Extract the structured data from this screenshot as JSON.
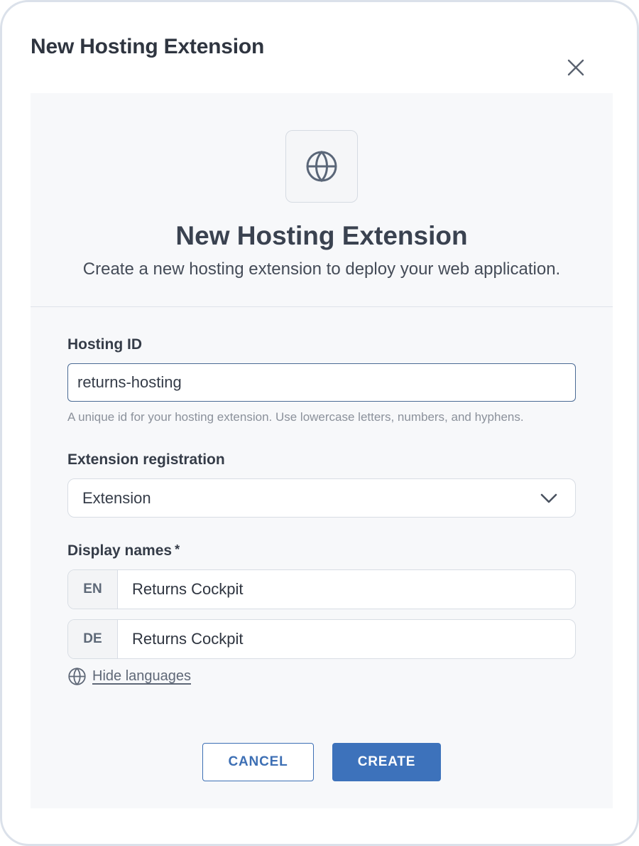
{
  "dialog": {
    "title": "New Hosting Extension"
  },
  "hero": {
    "icon": "globe-icon",
    "title": "New Hosting Extension",
    "subtitle": "Create a new hosting extension to deploy your web application."
  },
  "form": {
    "hosting_id": {
      "label": "Hosting ID",
      "value": "returns-hosting",
      "hint": "A unique id for your hosting extension. Use lowercase letters, numbers, and hyphens."
    },
    "registration": {
      "label": "Extension registration",
      "selected": "Extension"
    },
    "display_names": {
      "label": "Display names",
      "required_marker": "*",
      "languages": [
        {
          "code": "EN",
          "value": "Returns Cockpit"
        },
        {
          "code": "DE",
          "value": "Returns Cockpit"
        }
      ],
      "toggle_label": "Hide languages"
    }
  },
  "actions": {
    "cancel_label": "CANCEL",
    "create_label": "CREATE"
  },
  "colors": {
    "accent": "#3d72bb",
    "panel_bg": "#f7f8fa",
    "text": "#3a4250"
  }
}
